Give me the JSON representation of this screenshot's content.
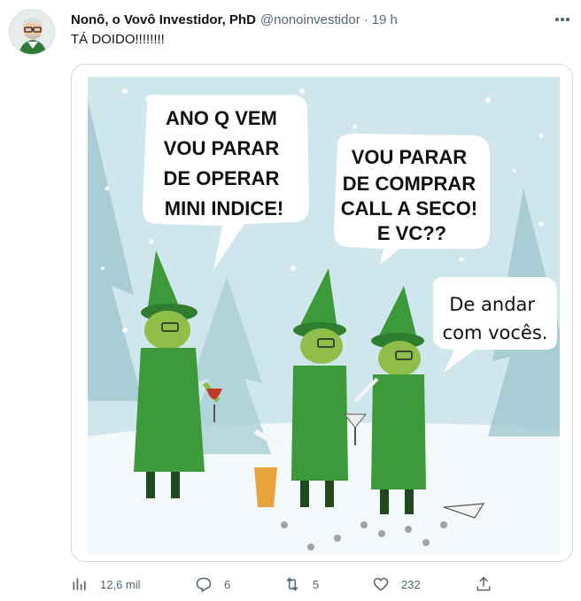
{
  "tweet": {
    "display_name": "Nonô, o Vovô Investidor, PhD",
    "handle": "@nonoinvestidor",
    "separator": "·",
    "time": "19 h",
    "text": "TÁ DOIDO!!!!!!!!"
  },
  "image": {
    "bubble_1": [
      "ANO Q VEM",
      "VOU PARAR",
      "DE OPERAR",
      "MINI INDICE!"
    ],
    "bubble_2": [
      "VOU PARAR",
      "DE COMPRAR",
      "CALL A SECO!",
      "E VC??"
    ],
    "bubble_3": [
      "De andar",
      "com vocês."
    ]
  },
  "actions": {
    "views": {
      "icon": "analytics-icon",
      "count": "12,6 mil"
    },
    "replies": {
      "icon": "reply-icon",
      "count": "6"
    },
    "retweets": {
      "icon": "retweet-icon",
      "count": "5"
    },
    "likes": {
      "icon": "heart-icon",
      "count": "232"
    },
    "share": {
      "icon": "share-icon"
    }
  },
  "colors": {
    "text_primary": "#0f1419",
    "text_secondary": "#536471",
    "sky": "#cfe6ec",
    "elf_green": "#3c9a3a",
    "elf_skin": "#8fbf4a"
  }
}
